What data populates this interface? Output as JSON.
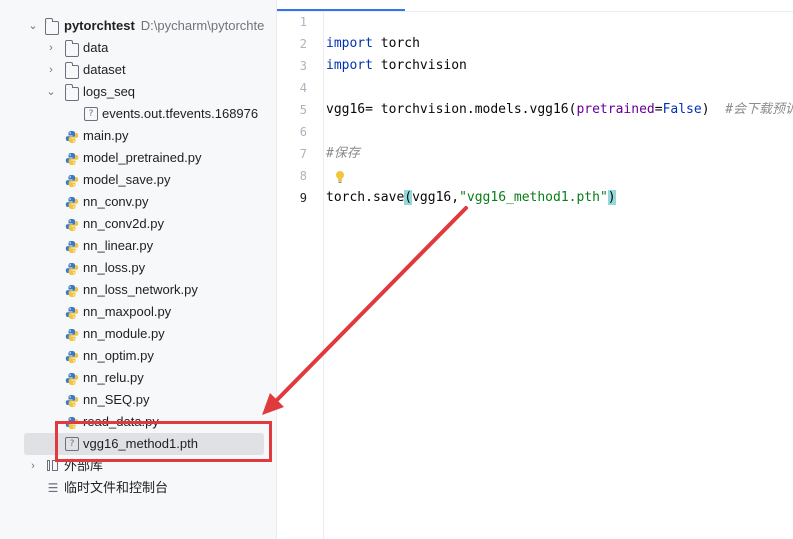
{
  "project_tree": {
    "root": {
      "name": "pytorchtest",
      "path": "D:\\pycharm\\pytorchte"
    },
    "items": [
      {
        "label": "data",
        "type": "folder",
        "icon": "folder-icon",
        "level": 1,
        "expander": "collapsed"
      },
      {
        "label": "dataset",
        "type": "folder",
        "icon": "folder-icon",
        "level": 1,
        "expander": "collapsed"
      },
      {
        "label": "logs_seq",
        "type": "folder",
        "icon": "folder-icon",
        "level": 1,
        "expander": "expanded"
      },
      {
        "label": "events.out.tfevents.168976",
        "type": "file",
        "icon": "unknown-file-icon",
        "level": 2
      },
      {
        "label": "main.py",
        "type": "file",
        "icon": "python-file-icon",
        "level": 1
      },
      {
        "label": "model_pretrained.py",
        "type": "file",
        "icon": "python-file-icon",
        "level": 1
      },
      {
        "label": "model_save.py",
        "type": "file",
        "icon": "python-file-icon",
        "level": 1
      },
      {
        "label": "nn_conv.py",
        "type": "file",
        "icon": "python-file-icon",
        "level": 1
      },
      {
        "label": "nn_conv2d.py",
        "type": "file",
        "icon": "python-file-icon",
        "level": 1
      },
      {
        "label": "nn_linear.py",
        "type": "file",
        "icon": "python-file-icon",
        "level": 1
      },
      {
        "label": "nn_loss.py",
        "type": "file",
        "icon": "python-file-icon",
        "level": 1
      },
      {
        "label": "nn_loss_network.py",
        "type": "file",
        "icon": "python-file-icon",
        "level": 1
      },
      {
        "label": "nn_maxpool.py",
        "type": "file",
        "icon": "python-file-icon",
        "level": 1
      },
      {
        "label": "nn_module.py",
        "type": "file",
        "icon": "python-file-icon",
        "level": 1
      },
      {
        "label": "nn_optim.py",
        "type": "file",
        "icon": "python-file-icon",
        "level": 1
      },
      {
        "label": "nn_relu.py",
        "type": "file",
        "icon": "python-file-icon",
        "level": 1
      },
      {
        "label": "nn_SEQ.py",
        "type": "file",
        "icon": "python-file-icon",
        "level": 1
      },
      {
        "label": "read_data.py",
        "type": "file",
        "icon": "python-file-icon",
        "level": 1
      },
      {
        "label": "vgg16_method1.pth",
        "type": "file",
        "icon": "unknown-file-icon",
        "level": 1,
        "selected": true
      }
    ],
    "external_libraries": "外部库",
    "scratches": "临时文件和控制台"
  },
  "editor": {
    "active_line": 9,
    "lines": [
      {
        "n": "1",
        "tokens": []
      },
      {
        "n": "2",
        "tokens": [
          {
            "t": "import",
            "c": "kw"
          },
          {
            "t": " torch",
            "c": ""
          }
        ]
      },
      {
        "n": "3",
        "tokens": [
          {
            "t": "import",
            "c": "kw"
          },
          {
            "t": " torchvision",
            "c": ""
          }
        ]
      },
      {
        "n": "4",
        "tokens": []
      },
      {
        "n": "5",
        "tokens": [
          {
            "t": "vgg16= torchvision.models.vgg16(",
            "c": ""
          },
          {
            "t": "pretrained",
            "c": "kwarg"
          },
          {
            "t": "=",
            "c": ""
          },
          {
            "t": "False",
            "c": "kw"
          },
          {
            "t": ")  ",
            "c": ""
          },
          {
            "t": "#会下载预训练",
            "c": "cmt"
          }
        ]
      },
      {
        "n": "6",
        "tokens": []
      },
      {
        "n": "7",
        "tokens": [
          {
            "t": "#保存",
            "c": "cmt"
          }
        ]
      },
      {
        "n": "8",
        "tokens": []
      },
      {
        "n": "9",
        "tokens": [
          {
            "t": "torch.save",
            "c": ""
          },
          {
            "t": "(",
            "c": "brh"
          },
          {
            "t": "vgg16,",
            "c": ""
          },
          {
            "t": "\"vgg16_method1.pth\"",
            "c": "str"
          },
          {
            "t": ")",
            "c": "brh"
          }
        ]
      }
    ]
  },
  "colors": {
    "annotation": "#e0393e",
    "selection": "#dfe1e5",
    "keyword": "#0033b3",
    "string": "#067d17",
    "comment": "#8c8c8c"
  }
}
